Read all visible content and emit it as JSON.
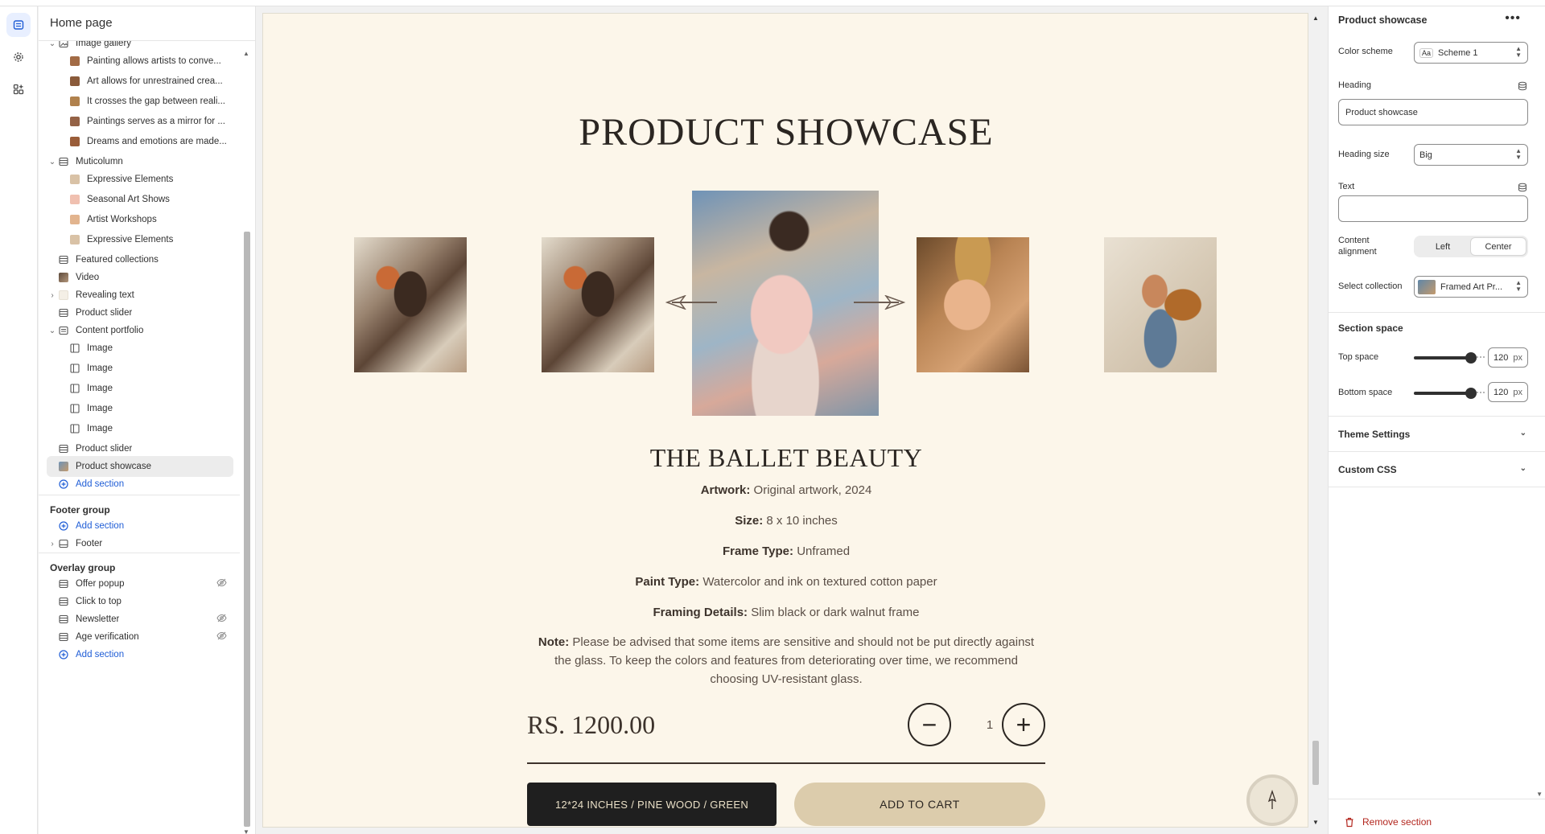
{
  "header": {
    "title": "Home page"
  },
  "sidebar": {
    "items": [
      {
        "label": "Image gallery",
        "kind": "section",
        "chevron": "down",
        "icon": "image-gallery-icon"
      },
      {
        "label": "Painting allows artists to conve...",
        "kind": "child-thumb",
        "thumb": "#a26b45"
      },
      {
        "label": "Art allows for unrestrained crea...",
        "kind": "child-thumb",
        "thumb": "#8a5a3a"
      },
      {
        "label": "It crosses the gap between reali...",
        "kind": "child-thumb",
        "thumb": "#b0814d"
      },
      {
        "label": "Paintings serves as a mirror for ...",
        "kind": "child-thumb",
        "thumb": "#946246"
      },
      {
        "label": "Dreams and emotions are made...",
        "kind": "child-thumb",
        "thumb": "#9a5d3a"
      },
      {
        "label": "Muticolumn",
        "kind": "section",
        "chevron": "down",
        "icon": "layout-icon"
      },
      {
        "label": "Expressive Elements",
        "kind": "child-thumb",
        "thumb": "#d9c2a6"
      },
      {
        "label": "Seasonal Art Shows",
        "kind": "child-thumb",
        "thumb": "#f0c0b0"
      },
      {
        "label": "Artist Workshops",
        "kind": "child-thumb",
        "thumb": "#e2b48e"
      },
      {
        "label": "Expressive Elements",
        "kind": "child-thumb",
        "thumb": "#d9c2a6"
      },
      {
        "label": "Featured collections",
        "kind": "section",
        "icon": "layout-icon"
      },
      {
        "label": "Video",
        "kind": "section",
        "icon": "video-icon"
      },
      {
        "label": "Revealing text",
        "kind": "section",
        "chevron": "right",
        "icon": "text-icon"
      },
      {
        "label": "Product slider",
        "kind": "section",
        "icon": "layout-icon"
      },
      {
        "label": "Content portfolio",
        "kind": "section",
        "chevron": "down",
        "icon": "content-icon"
      },
      {
        "label": "Image",
        "kind": "child-block"
      },
      {
        "label": "Image",
        "kind": "child-block"
      },
      {
        "label": "Image",
        "kind": "child-block"
      },
      {
        "label": "Image",
        "kind": "child-block"
      },
      {
        "label": "Image",
        "kind": "child-block"
      },
      {
        "label": "Product slider",
        "kind": "section",
        "icon": "layout-icon"
      },
      {
        "label": "Product showcase",
        "kind": "section",
        "icon": "image-thumb-icon",
        "selected": true
      }
    ],
    "add_section_label": "Add section",
    "footer_group": {
      "title": "Footer group",
      "add_label": "Add section",
      "items": [
        {
          "label": "Footer"
        }
      ]
    },
    "overlay_group": {
      "title": "Overlay group",
      "add_label": "Add section",
      "items": [
        {
          "label": "Offer popup",
          "hidden": true
        },
        {
          "label": "Click to top",
          "hidden": false
        },
        {
          "label": "Newsletter",
          "hidden": true
        },
        {
          "label": "Age verification",
          "hidden": true
        }
      ]
    }
  },
  "canvas": {
    "title": "PRODUCT SHOWCASE",
    "product_name": "THE BALLET BEAUTY",
    "specs": [
      {
        "label": "Artwork:",
        "value": "Original artwork, 2024"
      },
      {
        "label": "Size:",
        "value": "8 x 10 inches"
      },
      {
        "label": "Frame Type:",
        "value": "Unframed"
      },
      {
        "label": "Paint Type:",
        "value": " Watercolor and ink on textured cotton paper"
      },
      {
        "label": "Framing Details:",
        "value": "Slim black or dark walnut frame"
      }
    ],
    "note_label": "Note:",
    "note_text": "Please be advised that some items are sensitive and should not be put directly against the glass. To keep the colors and features from deteriorating over time, we recommend choosing UV-resistant glass.",
    "price": "RS. 1200.00",
    "quantity": "1",
    "variant_label": "12*24 INCHES / PINE WOOD / GREEN",
    "add_to_cart_label": "ADD TO CART"
  },
  "right_panel": {
    "title": "Product showcase",
    "color_scheme_label": "Color scheme",
    "color_scheme_value": "Scheme 1",
    "heading_label": "Heading",
    "heading_value": "Product showcase",
    "heading_size_label": "Heading size",
    "heading_size_value": "Big",
    "text_label": "Text",
    "text_value": "",
    "content_alignment_label": "Content alignment",
    "alignment_options": [
      "Left",
      "Center"
    ],
    "alignment_selected": "Center",
    "select_collection_label": "Select collection",
    "collection_value": "Framed Art Pr...",
    "section_space_title": "Section space",
    "top_space_label": "Top space",
    "top_space_value": "120",
    "bottom_space_label": "Bottom space",
    "bottom_space_value": "120",
    "unit": "px",
    "theme_settings_label": "Theme Settings",
    "custom_css_label": "Custom CSS",
    "remove_section_label": "Remove section"
  },
  "colors": {
    "canvas_bg": "#fcf6ea",
    "accent": "#1f5dd6",
    "danger": "#b3261e",
    "cart_button": "#dcccac",
    "variant_button": "#1f1f1f"
  }
}
